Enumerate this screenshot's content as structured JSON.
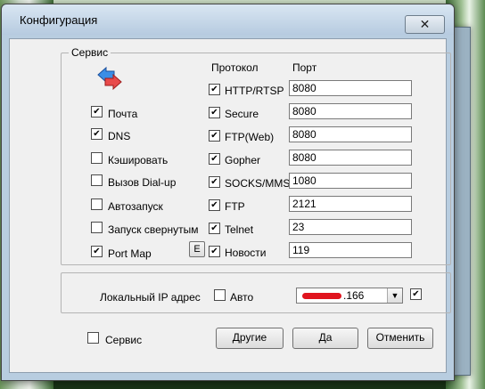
{
  "window": {
    "title": "Конфигурация",
    "close_glyph": "✕"
  },
  "service_group": {
    "legend": "Сервис",
    "items": [
      {
        "label": "Почта",
        "checked": true
      },
      {
        "label": "DNS",
        "checked": true
      },
      {
        "label": "Кэшировать",
        "checked": false
      },
      {
        "label": "Вызов Dial-up",
        "checked": false
      },
      {
        "label": "Автозапуск",
        "checked": false
      },
      {
        "label": "Запуск свернутым",
        "checked": false
      },
      {
        "label": "Port Map",
        "checked": true
      }
    ],
    "e_button": "E"
  },
  "protocols": {
    "header_protocol": "Протокол",
    "header_port": "Порт",
    "rows": [
      {
        "name": "HTTP/RTSP",
        "port": "8080",
        "checked": true
      },
      {
        "name": "Secure",
        "port": "8080",
        "checked": true
      },
      {
        "name": "FTP(Web)",
        "port": "8080",
        "checked": true
      },
      {
        "name": "Gopher",
        "port": "8080",
        "checked": true
      },
      {
        "name": "SOCKS/MMS",
        "port": "1080",
        "checked": true
      },
      {
        "name": "FTP",
        "port": "2121",
        "checked": true
      },
      {
        "name": "Telnet",
        "port": "23",
        "checked": true
      },
      {
        "name": "Новости",
        "port": "119",
        "checked": true
      }
    ]
  },
  "local_ip": {
    "label": "Локальный IP адрес",
    "auto_label": "Авто",
    "auto_checked": false,
    "ip_visible_suffix": ".166",
    "enable_checked": true
  },
  "footer": {
    "service_label": "Сервис",
    "service_checked": false,
    "other_button": "Другие",
    "ok_button": "Да",
    "cancel_button": "Отменить"
  }
}
